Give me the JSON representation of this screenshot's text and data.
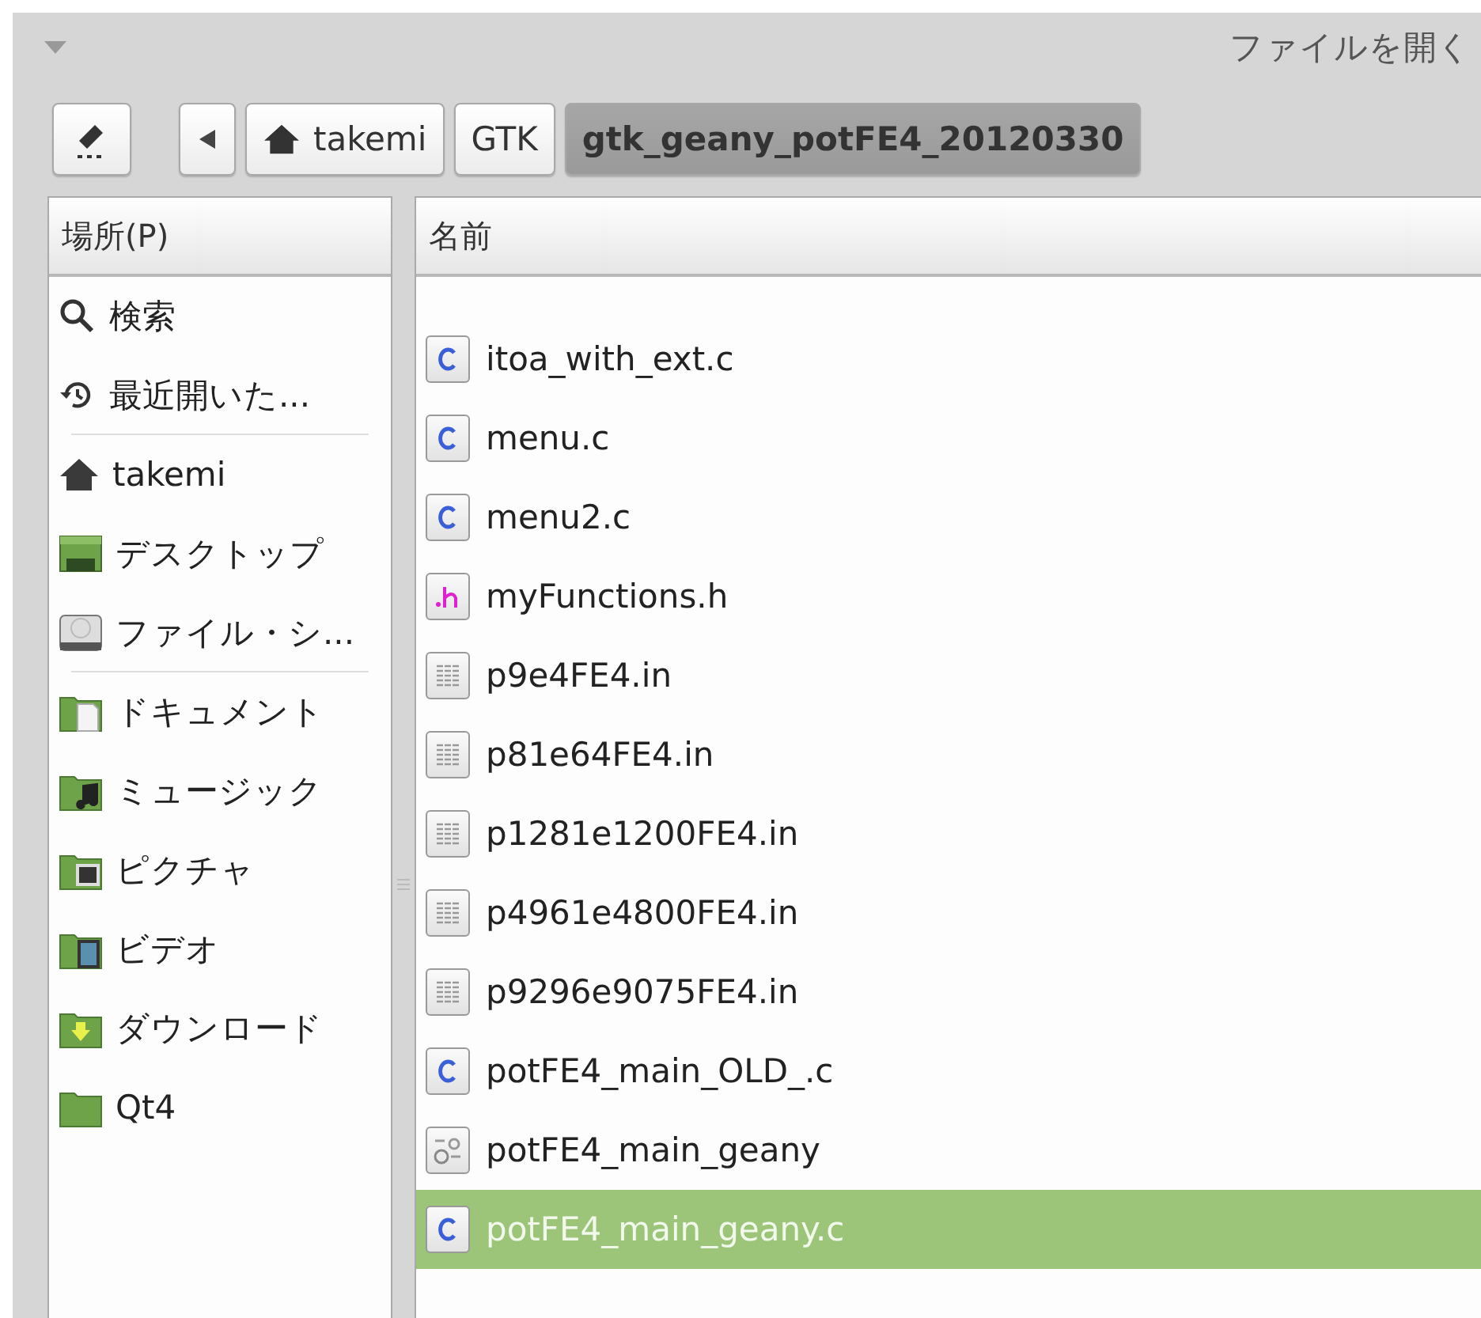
{
  "window": {
    "title": "ファイルを開く"
  },
  "path_bar": {
    "buttons": [
      {
        "label": "takemi",
        "kind": "home",
        "selected": false
      },
      {
        "label": "GTK",
        "kind": "folder",
        "selected": false
      },
      {
        "label": "gtk_geany_potFE4_20120330",
        "kind": "folder",
        "selected": true
      }
    ]
  },
  "places": {
    "header": "場所(P)",
    "groups": [
      [
        {
          "label": "検索",
          "kind": "search"
        },
        {
          "label": "最近開いた...",
          "kind": "recent"
        }
      ],
      [
        {
          "label": "takemi",
          "kind": "home"
        },
        {
          "label": "デスクトップ",
          "kind": "desktop"
        },
        {
          "label": "ファイル・シ...",
          "kind": "drive"
        }
      ],
      [
        {
          "label": "ドキュメント",
          "kind": "documents"
        },
        {
          "label": "ミュージック",
          "kind": "music"
        },
        {
          "label": "ピクチャ",
          "kind": "pictures"
        },
        {
          "label": "ビデオ",
          "kind": "video"
        },
        {
          "label": "ダウンロード",
          "kind": "download"
        },
        {
          "label": "Qt4",
          "kind": "folder"
        }
      ]
    ]
  },
  "files": {
    "header": "名前",
    "rows": [
      {
        "name": "itoa_with_ext.c",
        "kind": "c",
        "selected": false
      },
      {
        "name": "menu.c",
        "kind": "c",
        "selected": false
      },
      {
        "name": "menu2.c",
        "kind": "c",
        "selected": false
      },
      {
        "name": "myFunctions.h",
        "kind": "h",
        "selected": false
      },
      {
        "name": "p9e4FE4.in",
        "kind": "text",
        "selected": false
      },
      {
        "name": "p81e64FE4.in",
        "kind": "text",
        "selected": false
      },
      {
        "name": "p1281e1200FE4.in",
        "kind": "text",
        "selected": false
      },
      {
        "name": "p4961e4800FE4.in",
        "kind": "text",
        "selected": false
      },
      {
        "name": "p9296e9075FE4.in",
        "kind": "text",
        "selected": false
      },
      {
        "name": "potFE4_main_OLD_.c",
        "kind": "c",
        "selected": false
      },
      {
        "name": "potFE4_main_geany",
        "kind": "binary",
        "selected": false
      },
      {
        "name": "potFE4_main_geany.c",
        "kind": "c",
        "selected": true
      }
    ]
  }
}
